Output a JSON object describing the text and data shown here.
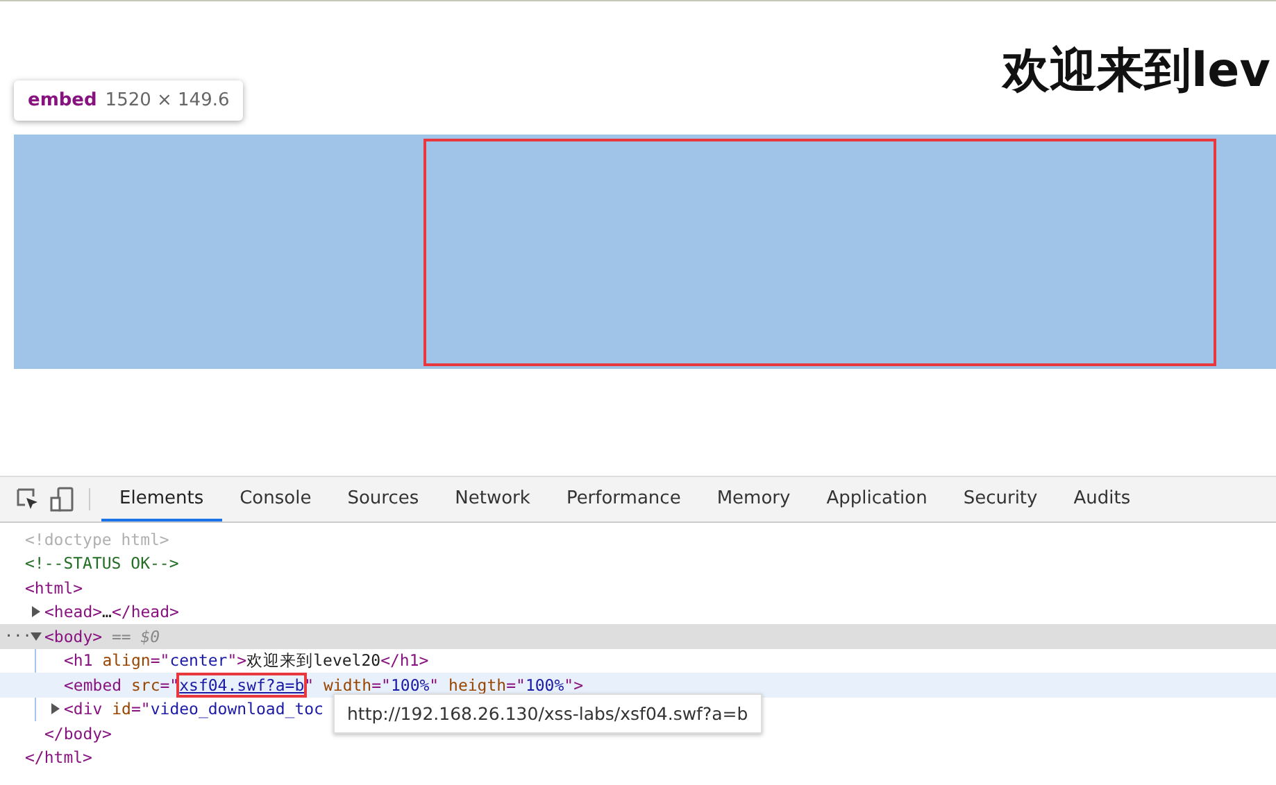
{
  "page": {
    "heading": "欢迎来到lev",
    "element_tooltip": {
      "tag": "embed",
      "size": "1520 × 149.6"
    },
    "embed_highlighted": true
  },
  "devtools": {
    "tabs": [
      {
        "label": "Elements",
        "selected": true
      },
      {
        "label": "Console",
        "selected": false
      },
      {
        "label": "Sources",
        "selected": false
      },
      {
        "label": "Network",
        "selected": false
      },
      {
        "label": "Performance",
        "selected": false
      },
      {
        "label": "Memory",
        "selected": false
      },
      {
        "label": "Application",
        "selected": false
      },
      {
        "label": "Security",
        "selected": false
      },
      {
        "label": "Audits",
        "selected": false
      }
    ],
    "dom_tree": [
      {
        "tokens": [
          {
            "kind": "doctype",
            "text": "<!doctype html>"
          }
        ],
        "selected": false,
        "hovered": false
      },
      {
        "tokens": [
          {
            "kind": "comment",
            "text": "<!--STATUS OK-->"
          }
        ],
        "selected": false,
        "hovered": false
      },
      {
        "tokens": [
          {
            "kind": "tag",
            "text": "<html>"
          }
        ],
        "selected": false,
        "hovered": false,
        "close_tokens": [
          {
            "kind": "tag",
            "text": "</html>"
          }
        ],
        "children": [
          {
            "tokens": [
              {
                "kind": "tag",
                "text": "<head>"
              },
              {
                "kind": "plain",
                "text": "…"
              },
              {
                "kind": "tag",
                "text": "</head>"
              }
            ],
            "expanded": false,
            "selected": false,
            "hovered": false
          },
          {
            "gutter_mark": "···",
            "tokens": [
              {
                "kind": "tag",
                "text": "<body>"
              },
              {
                "kind": "console",
                "text": " == $0"
              }
            ],
            "expanded": true,
            "selected": true,
            "hovered": false,
            "close_tokens": [
              {
                "kind": "tag",
                "text": "</body>"
              }
            ],
            "children": [
              {
                "tokens": [
                  {
                    "kind": "tag",
                    "text": "<h1 "
                  },
                  {
                    "kind": "attr",
                    "text": "align"
                  },
                  {
                    "kind": "tag",
                    "text": "=\""
                  },
                  {
                    "kind": "value",
                    "text": "center"
                  },
                  {
                    "kind": "tag",
                    "text": "\">"
                  },
                  {
                    "kind": "plain",
                    "text": "欢迎来到level20"
                  },
                  {
                    "kind": "tag",
                    "text": "</h1>"
                  }
                ],
                "selected": false,
                "hovered": false
              },
              {
                "tokens": [
                  {
                    "kind": "tag",
                    "text": "<embed "
                  },
                  {
                    "kind": "attr",
                    "text": "src"
                  },
                  {
                    "kind": "tag",
                    "text": "=\""
                  },
                  {
                    "kind": "link",
                    "text": "xsf04.swf?a=b",
                    "highlighted": true
                  },
                  {
                    "kind": "tag",
                    "text": "\" "
                  },
                  {
                    "kind": "attr",
                    "text": "width"
                  },
                  {
                    "kind": "tag",
                    "text": "=\""
                  },
                  {
                    "kind": "value",
                    "text": "100%"
                  },
                  {
                    "kind": "tag",
                    "text": "\" "
                  },
                  {
                    "kind": "attr",
                    "text": "heigth"
                  },
                  {
                    "kind": "tag",
                    "text": "=\""
                  },
                  {
                    "kind": "value",
                    "text": "100%"
                  },
                  {
                    "kind": "tag",
                    "text": "\">"
                  }
                ],
                "selected": false,
                "hovered": true
              },
              {
                "tokens": [
                  {
                    "kind": "tag",
                    "text": "<div "
                  },
                  {
                    "kind": "attr",
                    "text": "id"
                  },
                  {
                    "kind": "tag",
                    "text": "=\""
                  },
                  {
                    "kind": "value",
                    "text": "video_download_toc"
                  }
                ],
                "expanded": false,
                "selected": false,
                "hovered": false
              }
            ]
          }
        ]
      }
    ],
    "link_tooltip": "http://192.168.26.130/xss-labs/xsf04.swf?a=b"
  }
}
